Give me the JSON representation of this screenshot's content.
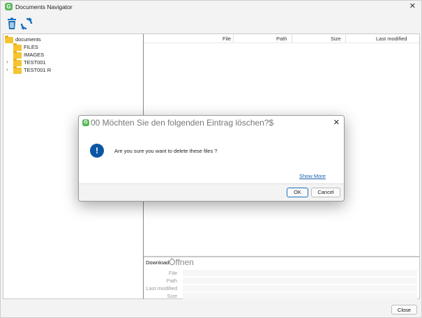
{
  "window": {
    "title": "Documents Navigator",
    "app_icon_letter": "G"
  },
  "toolbar": {
    "delete_icon": "trash-icon",
    "refresh_icon": "refresh-icon",
    "accent_color": "#1a6fbf"
  },
  "tree": {
    "root_label": "documents",
    "items": [
      {
        "label": "FILES",
        "expandable": false
      },
      {
        "label": "IMAGES",
        "expandable": false
      },
      {
        "label": "TEST001",
        "expandable": true
      },
      {
        "label": "TEST001 R",
        "expandable": true
      }
    ]
  },
  "list": {
    "columns": [
      "File",
      "Path",
      "Size",
      "Last modified"
    ]
  },
  "details": {
    "tab_download": "Download",
    "tab_open": "Öffnen",
    "labels": [
      "File",
      "Path",
      "Last modified",
      "Size"
    ]
  },
  "footer": {
    "close_label": "Close"
  },
  "dialog": {
    "icon_letter": "G",
    "title": "00 Möchten Sie den folgenden Eintrag löschen?$",
    "message": "Are you sure you want to delete these files ?",
    "show_more": "Show More",
    "ok_label": "OK",
    "cancel_label": "Cancel",
    "info_icon_glyph": "!"
  }
}
